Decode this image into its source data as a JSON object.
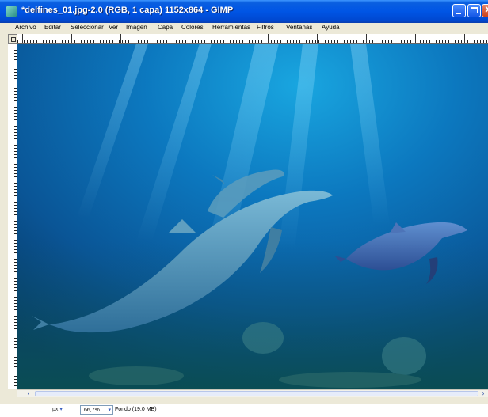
{
  "window": {
    "title": "*delfines_01.jpg-2.0 (RGB, 1 capa) 1152x864 - GIMP",
    "app_icon": "gimp-icon",
    "controls": [
      "minimize-icon",
      "maximize-icon",
      "close-icon"
    ]
  },
  "menu": {
    "items": [
      "Archivo",
      "Editar",
      "Seleccionar",
      "Ver",
      "Imagen",
      "Capa",
      "Colores",
      "Herramientas",
      "Filtros",
      "Ventanas",
      "Ayuda"
    ]
  },
  "canvas": {
    "image": "underwater-dolphins-photo",
    "colors": {
      "water_top": "#0f7fc2",
      "water_mid": "#0a5ea6",
      "water_bottom": "#063c62",
      "dolphin": "#4f93b8"
    }
  },
  "scrollbar": {
    "left_arrow": "‹",
    "right_arrow": "›"
  },
  "status": {
    "unit": "px",
    "unit_arrow": "▾",
    "zoom": "66,7%",
    "zoom_arrow": "▾",
    "layer_info": "Fondo (19,0 MB)"
  }
}
